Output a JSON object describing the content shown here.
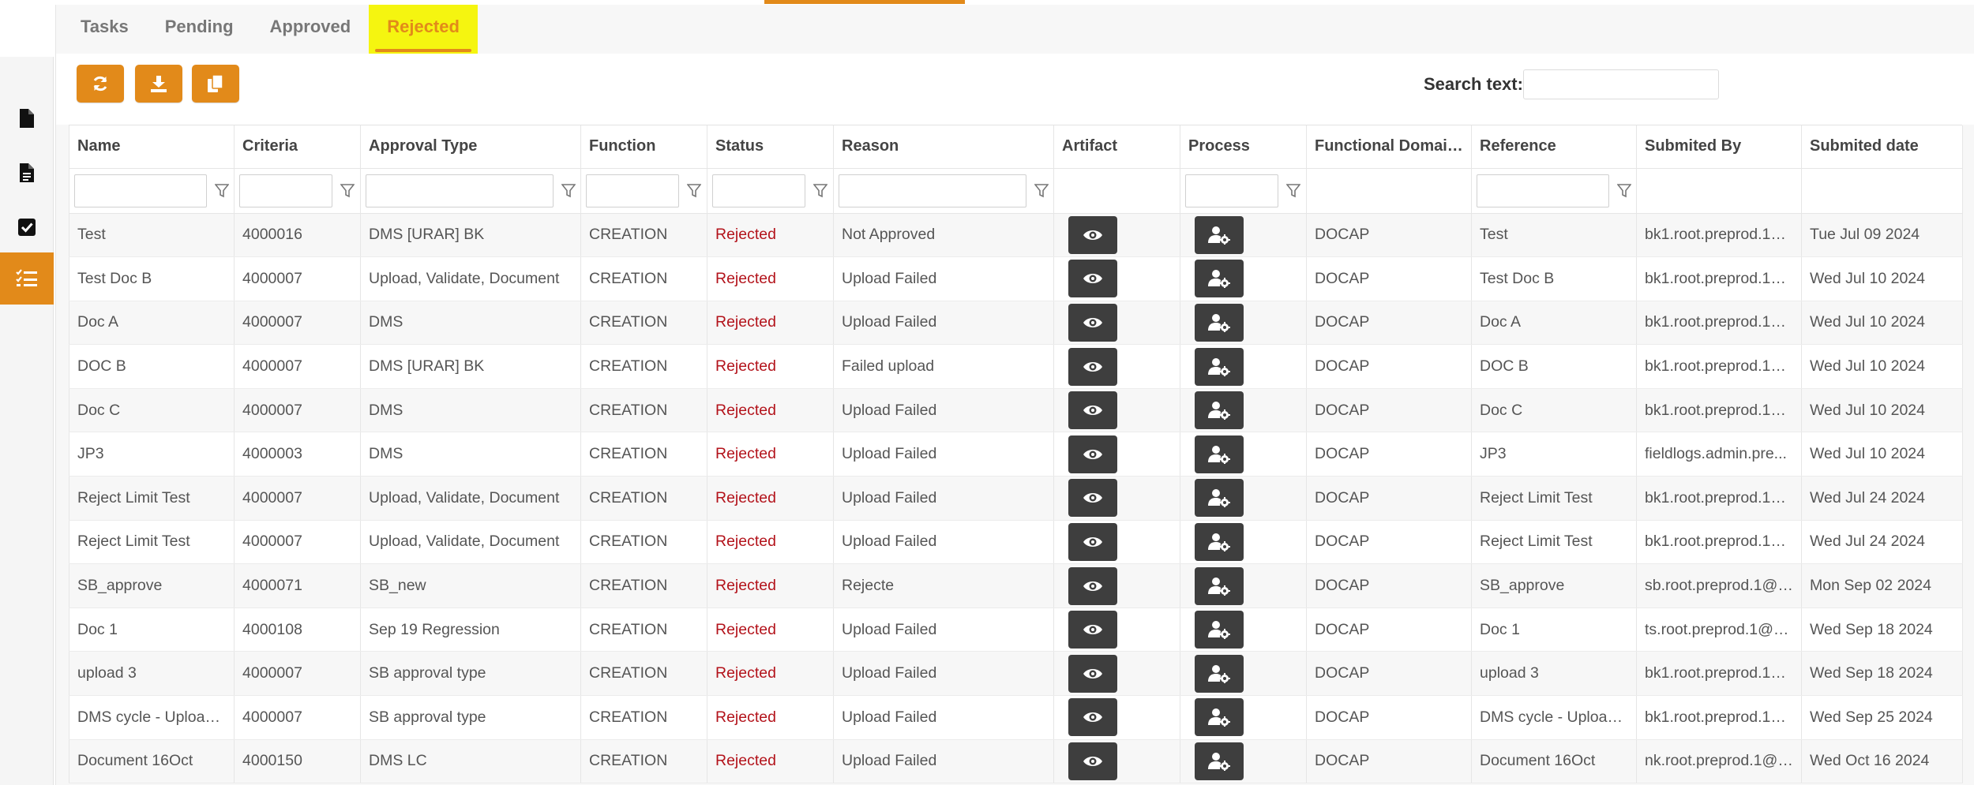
{
  "app": {
    "accent_color": "#e28a1a",
    "highlight_color": "#f5f510",
    "rejected_color": "#b3131b"
  },
  "sidebar": {
    "items": [
      {
        "icon": "document-icon",
        "active": false
      },
      {
        "icon": "document-lines-icon",
        "active": false
      },
      {
        "icon": "checkbox-icon",
        "active": false
      },
      {
        "icon": "checklist-icon",
        "active": true
      }
    ]
  },
  "tabs": [
    {
      "label": "Tasks",
      "active": false
    },
    {
      "label": "Pending",
      "active": false
    },
    {
      "label": "Approved",
      "active": false
    },
    {
      "label": "Rejected",
      "active": true
    }
  ],
  "toolbar": {
    "buttons": [
      {
        "icon": "refresh-icon"
      },
      {
        "icon": "download-icon"
      },
      {
        "icon": "copy-icon"
      }
    ],
    "search_label": "Search text:",
    "search_value": ""
  },
  "table": {
    "columns": [
      "Name",
      "Criteria",
      "Approval Type",
      "Function",
      "Status",
      "Reason",
      "Artifact",
      "Process",
      "Functional Domain...",
      "Reference",
      "Submited By",
      "Submited date"
    ],
    "filters": [
      true,
      true,
      true,
      true,
      true,
      true,
      false,
      true,
      false,
      true,
      false,
      false
    ],
    "rows": [
      {
        "name": "Test",
        "criteria": "4000016",
        "approval_type": "DMS [URAR] BK",
        "function": "CREATION",
        "status": "Rejected",
        "reason": "Not Approved",
        "domain": "DOCAP",
        "reference": "Test",
        "submitted_by": "bk1.root.preprod.1@...",
        "submitted_date": "Tue Jul 09 2024"
      },
      {
        "name": "Test Doc B",
        "criteria": "4000007",
        "approval_type": "Upload, Validate, Document",
        "function": "CREATION",
        "status": "Rejected",
        "reason": "Upload Failed",
        "domain": "DOCAP",
        "reference": "Test Doc B",
        "submitted_by": "bk1.root.preprod.1@...",
        "submitted_date": "Wed Jul 10 2024"
      },
      {
        "name": "Doc A",
        "criteria": "4000007",
        "approval_type": "DMS",
        "function": "CREATION",
        "status": "Rejected",
        "reason": "Upload Failed",
        "domain": "DOCAP",
        "reference": "Doc A",
        "submitted_by": "bk1.root.preprod.1@...",
        "submitted_date": "Wed Jul 10 2024"
      },
      {
        "name": "DOC B",
        "criteria": "4000007",
        "approval_type": "DMS [URAR] BK",
        "function": "CREATION",
        "status": "Rejected",
        "reason": "Failed upload",
        "domain": "DOCAP",
        "reference": "DOC B",
        "submitted_by": "bk1.root.preprod.1@...",
        "submitted_date": "Wed Jul 10 2024"
      },
      {
        "name": "Doc C",
        "criteria": "4000007",
        "approval_type": "DMS",
        "function": "CREATION",
        "status": "Rejected",
        "reason": "Upload Failed",
        "domain": "DOCAP",
        "reference": "Doc C",
        "submitted_by": "bk1.root.preprod.1@...",
        "submitted_date": "Wed Jul 10 2024"
      },
      {
        "name": "JP3",
        "criteria": "4000003",
        "approval_type": "DMS",
        "function": "CREATION",
        "status": "Rejected",
        "reason": "Upload Failed",
        "domain": "DOCAP",
        "reference": "JP3",
        "submitted_by": "fieldlogs.admin.pre...",
        "submitted_date": "Wed Jul 10 2024"
      },
      {
        "name": "Reject Limit Test",
        "criteria": "4000007",
        "approval_type": "Upload, Validate, Document",
        "function": "CREATION",
        "status": "Rejected",
        "reason": "Upload Failed",
        "domain": "DOCAP",
        "reference": "Reject Limit Test",
        "submitted_by": "bk1.root.preprod.1@...",
        "submitted_date": "Wed Jul 24 2024"
      },
      {
        "name": "Reject Limit Test",
        "criteria": "4000007",
        "approval_type": "Upload, Validate, Document",
        "function": "CREATION",
        "status": "Rejected",
        "reason": "Upload Failed",
        "domain": "DOCAP",
        "reference": "Reject Limit Test",
        "submitted_by": "bk1.root.preprod.1@...",
        "submitted_date": "Wed Jul 24 2024"
      },
      {
        "name": "SB_approve",
        "criteria": "4000071",
        "approval_type": "SB_new",
        "function": "CREATION",
        "status": "Rejected",
        "reason": "Rejecte",
        "domain": "DOCAP",
        "reference": "SB_approve",
        "submitted_by": "sb.root.preprod.1@p...",
        "submitted_date": "Mon Sep 02 2024"
      },
      {
        "name": "Doc 1",
        "criteria": "4000108",
        "approval_type": "Sep 19 Regression",
        "function": "CREATION",
        "status": "Rejected",
        "reason": "Upload Failed",
        "domain": "DOCAP",
        "reference": "Doc 1",
        "submitted_by": "ts.root.preprod.1@pt...",
        "submitted_date": "Wed Sep 18 2024"
      },
      {
        "name": "upload 3",
        "criteria": "4000007",
        "approval_type": "SB approval type",
        "function": "CREATION",
        "status": "Rejected",
        "reason": "Upload Failed",
        "domain": "DOCAP",
        "reference": "upload 3",
        "submitted_by": "bk1.root.preprod.1@...",
        "submitted_date": "Wed Sep 18 2024"
      },
      {
        "name": "DMS cycle - Upload ...",
        "criteria": "4000007",
        "approval_type": "SB approval type",
        "function": "CREATION",
        "status": "Rejected",
        "reason": "Upload Failed",
        "domain": "DOCAP",
        "reference": "DMS cycle - Upload...",
        "submitted_by": "bk1.root.preprod.1@...",
        "submitted_date": "Wed Sep 25 2024"
      },
      {
        "name": "Document 16Oct",
        "criteria": "4000150",
        "approval_type": "DMS LC",
        "function": "CREATION",
        "status": "Rejected",
        "reason": "Upload Failed",
        "domain": "DOCAP",
        "reference": "Document 16Oct",
        "submitted_by": "nk.root.preprod.1@p...",
        "submitted_date": "Wed Oct 16 2024"
      }
    ],
    "artifact_icon": "eye-icon",
    "process_icon": "user-gear-icon"
  }
}
